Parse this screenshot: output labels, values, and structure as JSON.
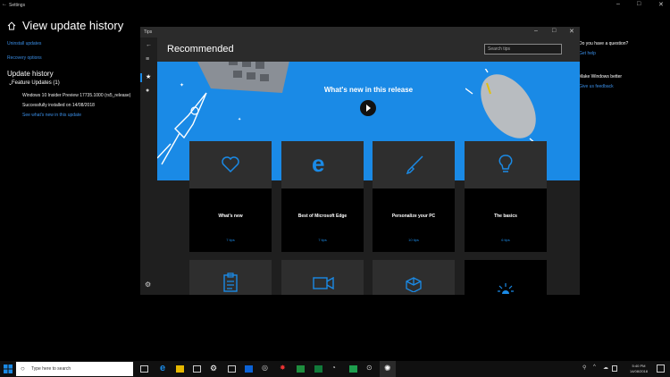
{
  "settings": {
    "window_title": "Settings",
    "page_title": "View update history",
    "links": {
      "uninstall": "Uninstall updates",
      "recovery": "Recovery options"
    },
    "update_history_title": "Update history",
    "feature_updates_title": "Feature Updates (1)",
    "update_entry": {
      "name": "Windows 10 Insider Preview 17735.1000 (rs5_release)",
      "status": "Successfully installed on 14/08/2018",
      "link": "See what's new in this update"
    },
    "right_column": {
      "question": "Do you have a question?",
      "get_help": "Get help",
      "make_better": "Make Windows better",
      "feedback": "Give us feedback"
    }
  },
  "tips": {
    "window_title": "Tips",
    "heading": "Recommended",
    "search_placeholder": "Search tips",
    "hero_title": "What's new in this release",
    "cards": [
      {
        "label": "What's new",
        "count": "7 tips",
        "icon": "heart-icon"
      },
      {
        "label": "Best of Microsoft Edge",
        "count": "7 tips",
        "icon": "edge-icon"
      },
      {
        "label": "Personalize your PC",
        "count": "10 tips",
        "icon": "paintbrush-icon"
      },
      {
        "label": "The basics",
        "count": "6 tips",
        "icon": "lightbulb-icon"
      }
    ],
    "row2_icons": [
      "clipboard-icon",
      "video-camera-icon",
      "shapes-icon",
      "bulb-sparkle-icon"
    ]
  },
  "taskbar": {
    "search_placeholder": "Type here to search",
    "time": "5:40 PM",
    "date": "14/08/2018"
  },
  "colors": {
    "accent": "#1a8ae6",
    "hero_bg": "#1a8ae6"
  }
}
